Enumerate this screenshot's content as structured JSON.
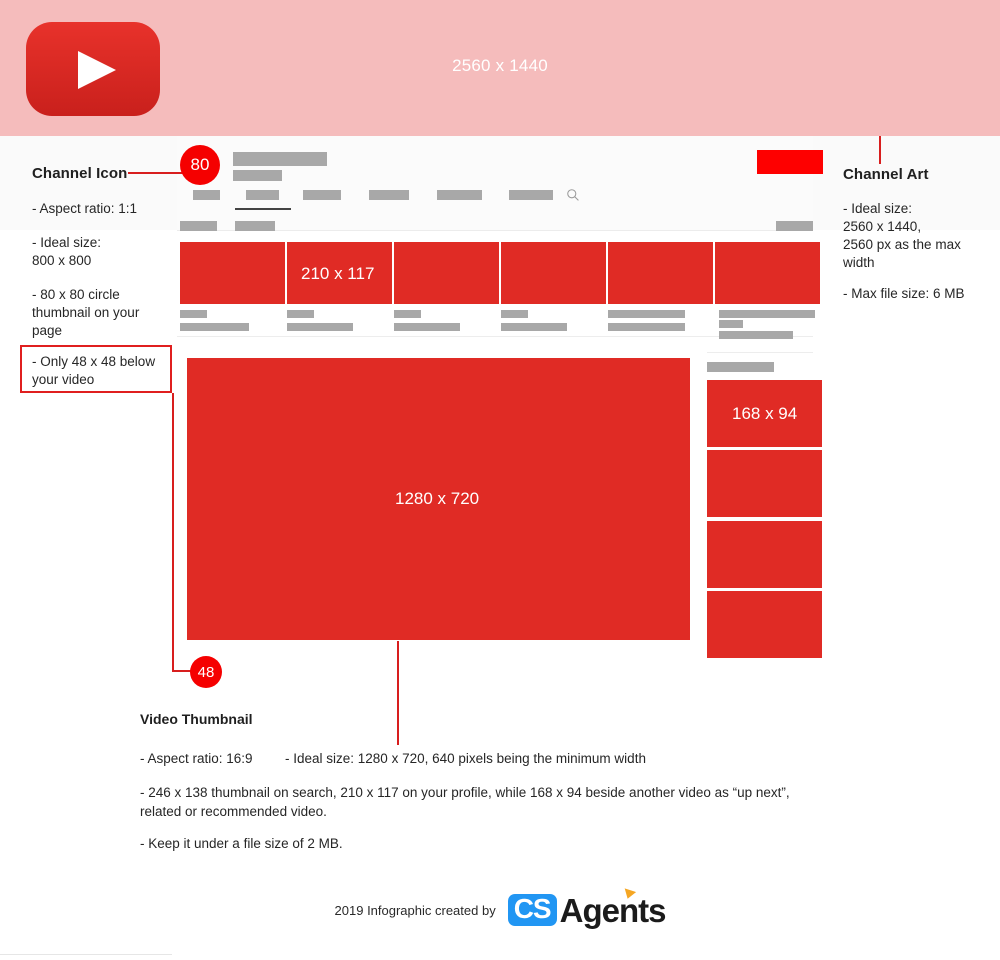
{
  "banner": {
    "size_label": "2560 x 1440",
    "logo_name": "youtube-logo"
  },
  "channel_icon": {
    "title": "Channel Icon",
    "badge": "80",
    "lines": [
      "- Aspect ratio: 1:1",
      "- Ideal size:\n800 x 800",
      "- 80 x 80 circle\nthumbnail on your\npage"
    ],
    "highlight": "- Only 48 x 48 below\nyour video"
  },
  "channel_art": {
    "title": "Channel Art",
    "lines": [
      "- Ideal size:\n2560 x 1440,\n2560 px as the max\nwidth",
      "- Max file size: 6 MB"
    ]
  },
  "mock": {
    "profile_thumb_label": "210 x 117",
    "upnext_thumb_label": "168 x 94",
    "player_label": "1280 x 720",
    "search_icon": "search-icon",
    "subscribe_button": "subscribe-button",
    "tab_count": 6,
    "active_tab_index": 1
  },
  "video_thumbnail": {
    "badge": "48",
    "title": "Video Thumbnail",
    "aspect": "- Aspect ratio: 16:9",
    "ideal": "- Ideal size: 1280 x 720, 640 pixels being the minimum width",
    "sizes": "- 246 x 138 thumbnail on search, 210 x 117 on your profile, while 168 x 94 beside another video as “up next”, related or recommended video.",
    "filesize": "- Keep it under a file size of 2 MB."
  },
  "footer": {
    "credit": "2019 Infographic created by",
    "logo_cs": "CS",
    "logo_agents": "Agents"
  },
  "colors": {
    "banner_bg": "#f5bcbc",
    "thumb_red": "#e02b25",
    "badge_red": "#f50000",
    "accent_line": "#d81e1e",
    "logo_blue": "#2196f3",
    "logo_orange": "#f5a623",
    "placeholder_grey": "#a8a8a8"
  }
}
